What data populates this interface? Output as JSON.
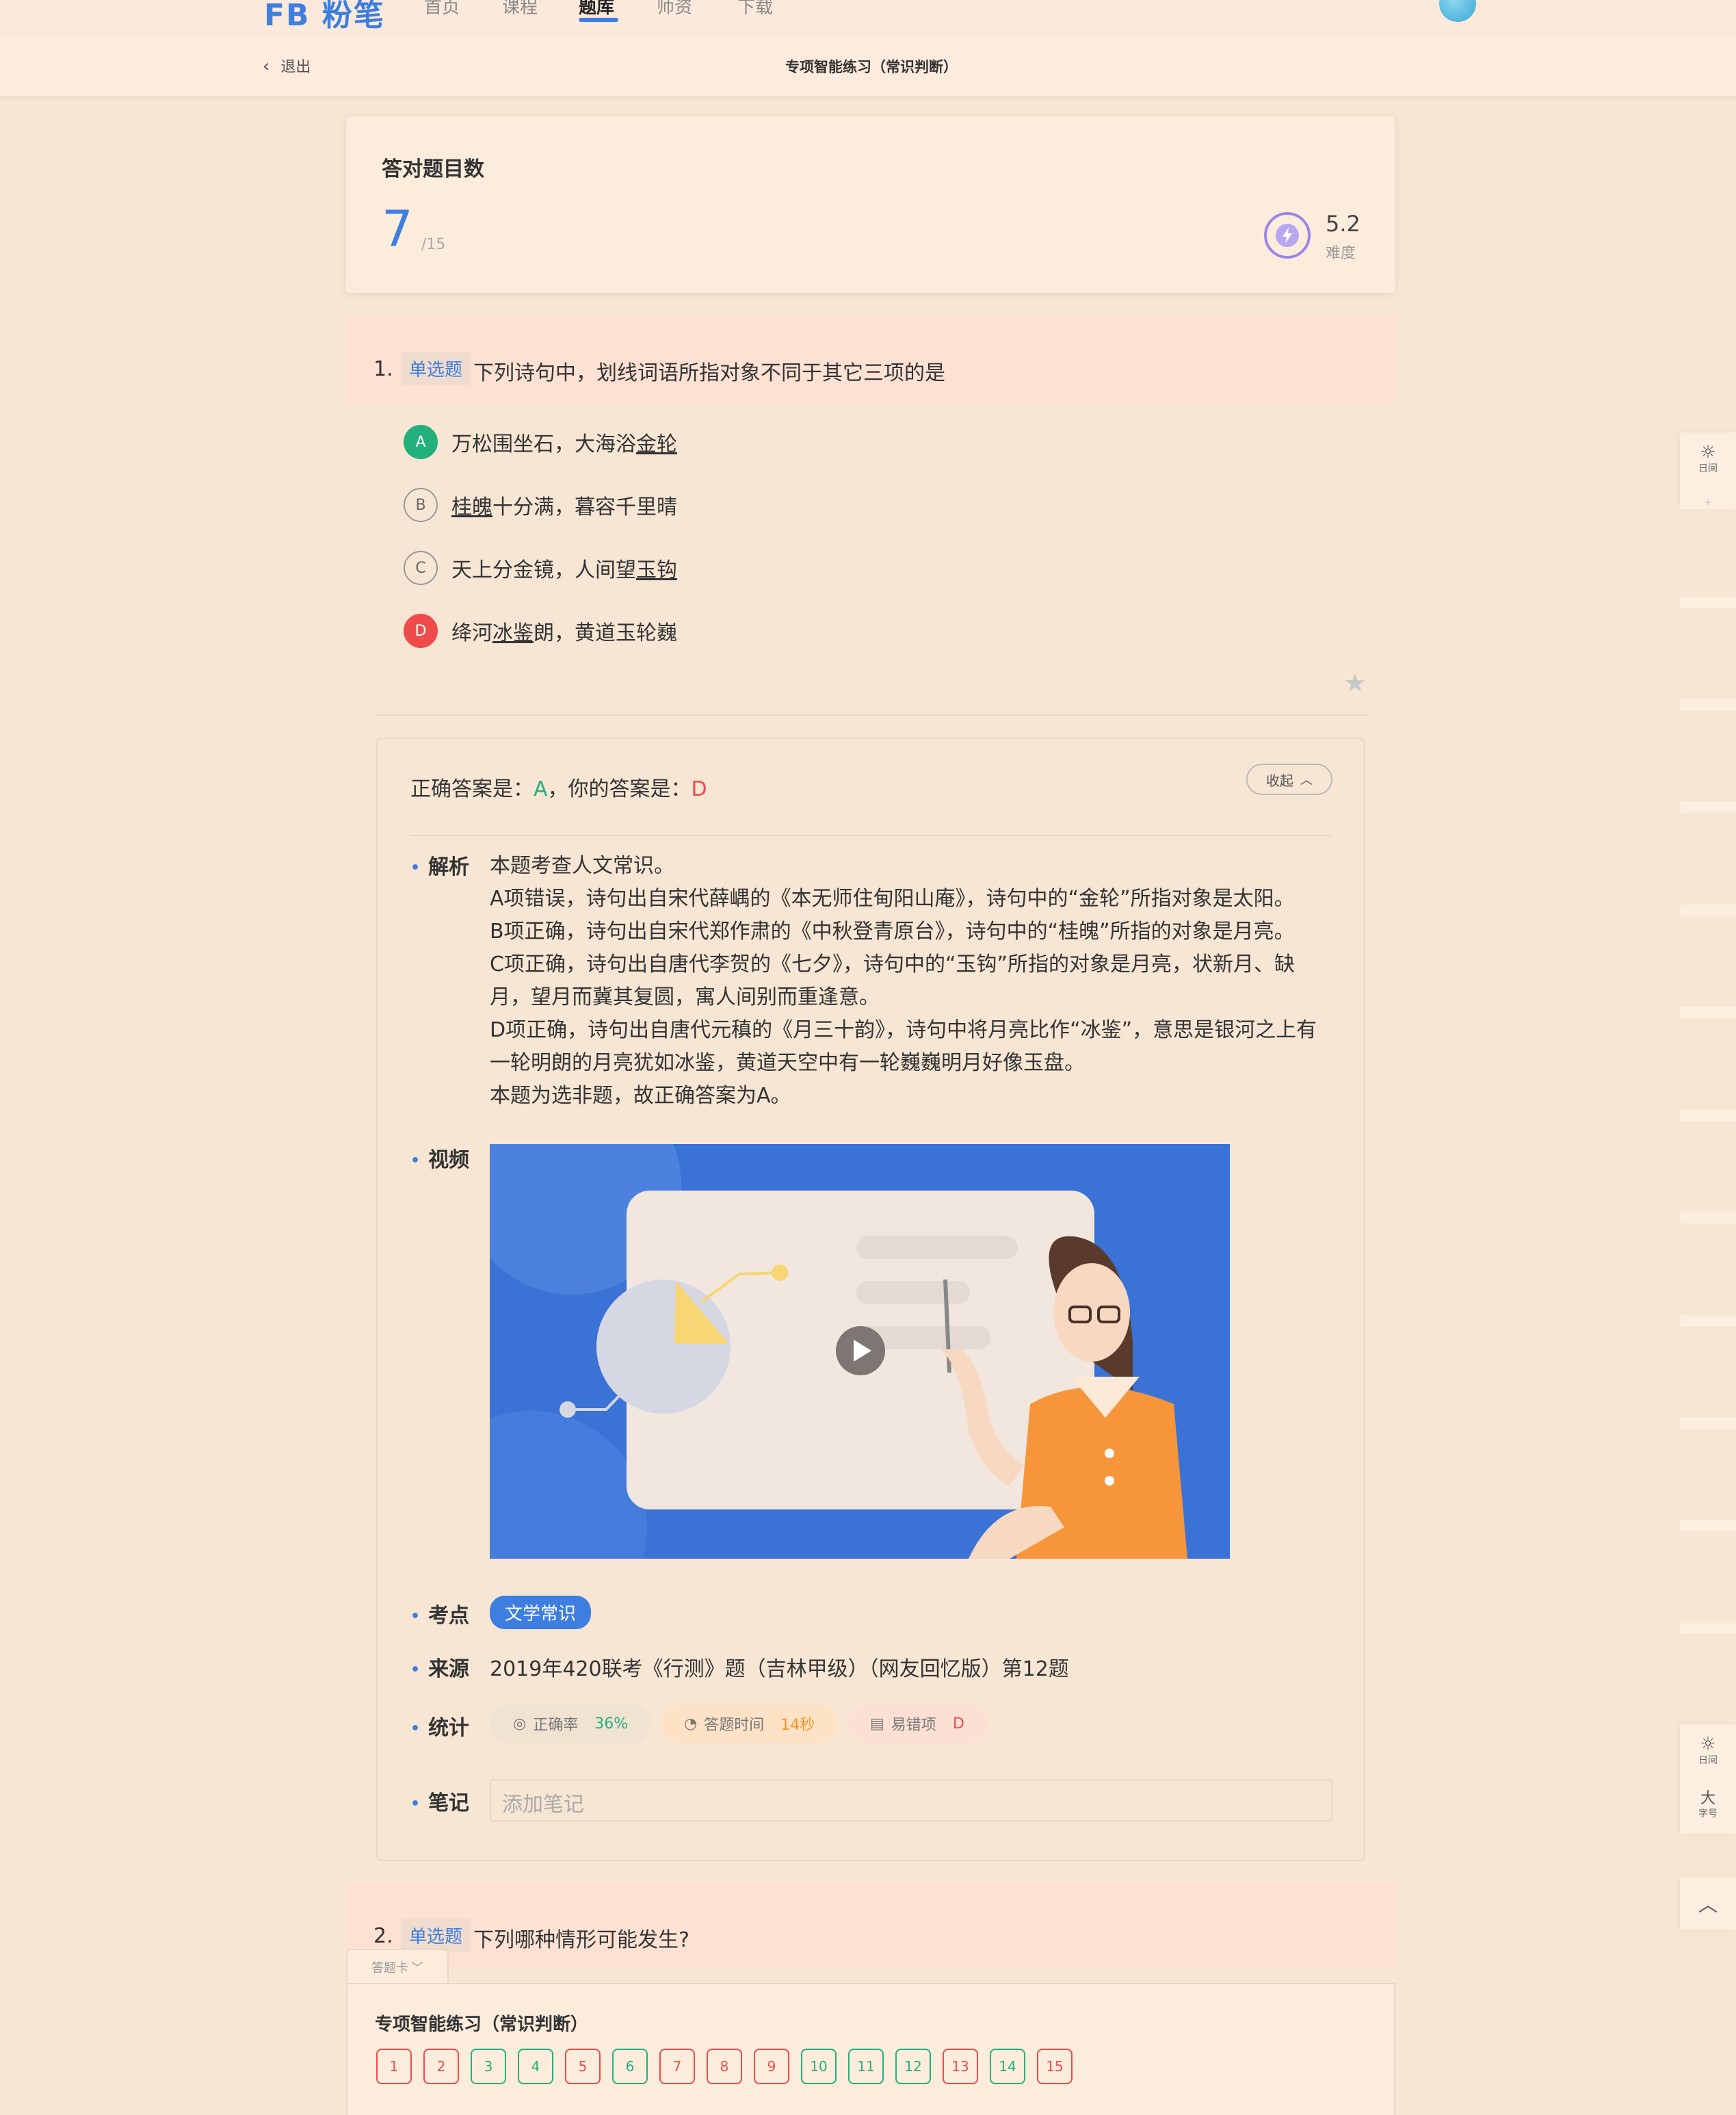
{
  "nav": {
    "logo": "FB 粉笔",
    "items": [
      "首页",
      "课程",
      "题库",
      "师资",
      "下载"
    ],
    "active_index": 2
  },
  "subbar": {
    "back_label": "退出",
    "title": "专项智能练习（常识判断）"
  },
  "score": {
    "title": "答对题目数",
    "correct": "7",
    "total": "/15",
    "difficulty_value": "5.2",
    "difficulty_label": "难度"
  },
  "question1": {
    "number": "1.",
    "type": "单选题",
    "text": "下列诗句中，划线词语所指对象不同于其它三项的是",
    "options": [
      {
        "letter": "A",
        "pre": "万松围坐石，大海浴",
        "u": "金轮",
        "post": "",
        "state": "correct"
      },
      {
        "letter": "B",
        "pre": "",
        "u": "桂魄",
        "post": "十分满，暮容千里晴",
        "state": "none"
      },
      {
        "letter": "C",
        "pre": "天上分金镜，人间望",
        "u": "玉钩",
        "post": "",
        "state": "none"
      },
      {
        "letter": "D",
        "pre": "绛河",
        "u": "冰鉴",
        "post": "朗，黄道玉轮巍",
        "state": "wrong"
      }
    ]
  },
  "answer": {
    "correct_prefix": "正确答案是：",
    "correct_letter": "A",
    "mid": "，你的答案是：",
    "your_letter": "D",
    "collapse_label": "收起"
  },
  "analysis": {
    "label": "解析",
    "lines": [
      "本题考查人文常识。",
      "A项错误，诗句出自宋代薛嵎的《本无师住甸阳山庵》，诗句中的“金轮”所指对象是太阳。",
      "B项正确，诗句出自宋代郑作肃的《中秋登青原台》，诗句中的“桂魄”所指的对象是月亮。",
      "C项正确，诗句出自唐代李贺的《七夕》，诗句中的“玉钩”所指的对象是月亮，状新月、缺",
      "月，望月而冀其复圆，寓人间别而重逢意。",
      "D项正确，诗句出自唐代元稹的《月三十韵》，诗句中将月亮比作“冰鉴”，意思是银河之上有",
      "一轮明朗的月亮犹如冰鉴，黄道天空中有一轮巍巍明月好像玉盘。",
      "本题为选非题，故正确答案为A。"
    ]
  },
  "video": {
    "label": "视频"
  },
  "point": {
    "label": "考点",
    "tag": "文学常识"
  },
  "source": {
    "label": "来源",
    "text": "2019年420联考《行测》题（吉林甲级）（网友回忆版）第12题"
  },
  "stats": {
    "label": "统计",
    "accuracy_label": "正确率",
    "accuracy": "36%",
    "time_label": "答题时间",
    "time": "14秒",
    "error_label": "易错项",
    "error": "D"
  },
  "note": {
    "label": "笔记",
    "placeholder": "添加笔记"
  },
  "question2": {
    "number": "2.",
    "type": "单选题",
    "text": "下列哪种情形可能发生?"
  },
  "answer_card": {
    "tab_label": "答题卡",
    "title": "专项智能练习（常识判断）",
    "items": [
      {
        "n": "1",
        "s": "r"
      },
      {
        "n": "2",
        "s": "r"
      },
      {
        "n": "3",
        "s": "g"
      },
      {
        "n": "4",
        "s": "g"
      },
      {
        "n": "5",
        "s": "r"
      },
      {
        "n": "6",
        "s": "g"
      },
      {
        "n": "7",
        "s": "r"
      },
      {
        "n": "8",
        "s": "r"
      },
      {
        "n": "9",
        "s": "r"
      },
      {
        "n": "10",
        "s": "g"
      },
      {
        "n": "11",
        "s": "g"
      },
      {
        "n": "12",
        "s": "g"
      },
      {
        "n": "13",
        "s": "r"
      },
      {
        "n": "14",
        "s": "g"
      },
      {
        "n": "15",
        "s": "r"
      }
    ]
  },
  "side": {
    "day_label": "日间",
    "font_icon": "大",
    "font_label": "字号"
  },
  "colors": {
    "accent": "#3d7ee0",
    "correct": "#22b07d",
    "wrong": "#ef4b4b",
    "background": "#f7e6d4"
  }
}
